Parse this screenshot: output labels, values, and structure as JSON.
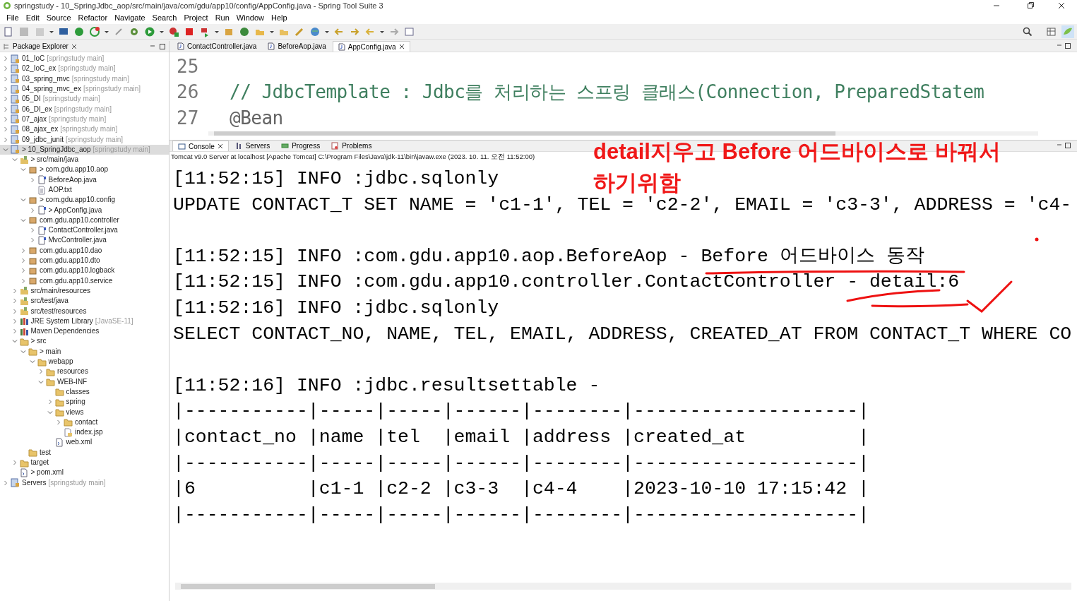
{
  "window": {
    "title": "springstudy - 10_SpringJdbc_aop/src/main/java/com/gdu/app10/config/AppConfig.java - Spring Tool Suite 3"
  },
  "menu": [
    "File",
    "Edit",
    "Source",
    "Refactor",
    "Navigate",
    "Search",
    "Project",
    "Run",
    "Window",
    "Help"
  ],
  "explorer": {
    "title": "Package Explorer",
    "items": [
      {
        "kind": "project",
        "label": "01_IoC",
        "detail": "[springstudy main]",
        "expanded": false,
        "selected": false
      },
      {
        "kind": "project",
        "label": "02_IoC_ex",
        "detail": "[springstudy main]",
        "expanded": false,
        "selected": false
      },
      {
        "kind": "project",
        "label": "03_spring_mvc",
        "detail": "[springstudy main]",
        "expanded": false,
        "selected": false
      },
      {
        "kind": "project",
        "label": "04_spring_mvc_ex",
        "detail": "[springstudy main]",
        "expanded": false,
        "selected": false
      },
      {
        "kind": "project",
        "label": "05_DI",
        "detail": "[springstudy main]",
        "expanded": false,
        "selected": false
      },
      {
        "kind": "project",
        "label": "06_DI_ex",
        "detail": "[springstudy main]",
        "expanded": false,
        "selected": false
      },
      {
        "kind": "project",
        "label": "07_ajax",
        "detail": "[springstudy main]",
        "expanded": false,
        "selected": false
      },
      {
        "kind": "project",
        "label": "08_ajax_ex",
        "detail": "[springstudy main]",
        "expanded": false,
        "selected": false
      },
      {
        "kind": "project",
        "label": "09_jdbc_junit",
        "detail": "[springstudy main]",
        "expanded": false,
        "selected": false
      },
      {
        "kind": "project",
        "label": "> 10_SpringJdbc_aop",
        "detail": "[springstudy main]",
        "expanded": true,
        "selected": true,
        "children": [
          {
            "kind": "source",
            "label": "> src/main/java",
            "expanded": true,
            "selected": false,
            "children": [
              {
                "kind": "package",
                "label": "> com.gdu.app10.aop",
                "expanded": true,
                "selected": false,
                "children": [
                  {
                    "kind": "java",
                    "label": "BeforeAop.java",
                    "expanded": false,
                    "selected": false
                  },
                  {
                    "kind": "text",
                    "label": "AOP.txt",
                    "selected": false
                  }
                ]
              },
              {
                "kind": "package",
                "label": "> com.gdu.app10.config",
                "expanded": true,
                "selected": false,
                "children": [
                  {
                    "kind": "java",
                    "label": "> AppConfig.java",
                    "expanded": false,
                    "selected": false
                  }
                ]
              },
              {
                "kind": "package",
                "label": "com.gdu.app10.controller",
                "expanded": true,
                "selected": false,
                "children": [
                  {
                    "kind": "java",
                    "label": "ContactController.java",
                    "expanded": false,
                    "selected": false
                  },
                  {
                    "kind": "java",
                    "label": "MvcController.java",
                    "expanded": false,
                    "selected": false
                  }
                ]
              },
              {
                "kind": "package",
                "label": "com.gdu.app10.dao",
                "expanded": false,
                "selected": false
              },
              {
                "kind": "package",
                "label": "com.gdu.app10.dto",
                "expanded": false,
                "selected": false
              },
              {
                "kind": "package",
                "label": "com.gdu.app10.logback",
                "expanded": false,
                "selected": false
              },
              {
                "kind": "package",
                "label": "com.gdu.app10.service",
                "expanded": false,
                "selected": false
              }
            ]
          },
          {
            "kind": "source",
            "label": "src/main/resources",
            "expanded": false,
            "selected": false
          },
          {
            "kind": "source",
            "label": "src/test/java",
            "expanded": false,
            "selected": false
          },
          {
            "kind": "source",
            "label": "src/test/resources",
            "expanded": false,
            "selected": false
          },
          {
            "kind": "library",
            "label": "JRE System Library",
            "detail": "[JavaSE-11]",
            "expanded": false,
            "selected": false
          },
          {
            "kind": "library",
            "label": "Maven Dependencies",
            "expanded": false,
            "selected": false
          },
          {
            "kind": "folder",
            "label": "> src",
            "expanded": true,
            "selected": false,
            "children": [
              {
                "kind": "folder",
                "label": "> main",
                "expanded": true,
                "selected": false,
                "children": [
                  {
                    "kind": "folder",
                    "label": "webapp",
                    "expanded": true,
                    "selected": false,
                    "children": [
                      {
                        "kind": "folder",
                        "label": "resources",
                        "expanded": false,
                        "selected": false
                      },
                      {
                        "kind": "folder",
                        "label": "WEB-INF",
                        "expanded": true,
                        "selected": false,
                        "children": [
                          {
                            "kind": "folder",
                            "label": "classes",
                            "selected": false
                          },
                          {
                            "kind": "folder",
                            "label": "spring",
                            "expanded": false,
                            "selected": false
                          },
                          {
                            "kind": "folder",
                            "label": "views",
                            "expanded": true,
                            "selected": false,
                            "children": [
                              {
                                "kind": "folder",
                                "label": "contact",
                                "expanded": false,
                                "selected": false
                              },
                              {
                                "kind": "jsp",
                                "label": "index.jsp",
                                "selected": false
                              }
                            ]
                          },
                          {
                            "kind": "xml",
                            "label": "web.xml",
                            "selected": false
                          }
                        ]
                      }
                    ]
                  }
                ]
              },
              {
                "kind": "folder",
                "label": "test",
                "selected": false
              }
            ]
          },
          {
            "kind": "folder",
            "label": "target",
            "expanded": false,
            "selected": false
          },
          {
            "kind": "xml",
            "label": "> pom.xml",
            "selected": false
          }
        ]
      },
      {
        "kind": "project",
        "label": "Servers",
        "detail": "[springstudy main]",
        "expanded": false,
        "selected": false
      }
    ]
  },
  "editor": {
    "tabs": [
      {
        "label": "ContactController.java",
        "selected": false
      },
      {
        "label": "BeforeAop.java",
        "selected": false
      },
      {
        "label": "AppConfig.java",
        "selected": true
      }
    ],
    "lines": [
      {
        "number": "25"
      },
      {
        "number": "26",
        "text": "// JdbcTemplate : Jdbc를 처리하는 스프링 클래스(Connection, PreparedStatem",
        "kind": "comment"
      },
      {
        "number": "27",
        "text": "@Bean",
        "kind": "annotation"
      }
    ]
  },
  "console": {
    "tabs": [
      {
        "label": "Console",
        "selected": true
      },
      {
        "label": "Servers",
        "selected": false
      },
      {
        "label": "Progress",
        "selected": false
      },
      {
        "label": "Problems",
        "selected": false
      }
    ],
    "process": "Tomcat v9.0 Server at localhost [Apache Tomcat] C:\\Program Files\\Java\\jdk-11\\bin\\javaw.exe  (2023. 10. 11. 오전 11:52:00)",
    "lines": [
      {
        "kind": "text",
        "text": "[11:52:15] INFO :jdbc.sqlonly"
      },
      {
        "kind": "text",
        "text": "UPDATE CONTACT_T SET NAME = 'c1-1', TEL = 'c2-2', EMAIL = 'c3-3', ADDRESS = 'c4-"
      },
      {
        "kind": "blank"
      },
      {
        "kind": "text",
        "text": "[11:52:15] INFO :com.gdu.app10.aop.BeforeAop - Before 어드바이스 동작"
      },
      {
        "kind": "text",
        "text": "[11:52:15] INFO :com.gdu.app10.controller.ContactController - detail:6"
      },
      {
        "kind": "text",
        "text": "[11:52:16] INFO :jdbc.sqlonly"
      },
      {
        "kind": "text",
        "text": "SELECT CONTACT_NO, NAME, TEL, EMAIL, ADDRESS, CREATED_AT FROM CONTACT_T WHERE CO"
      },
      {
        "kind": "blank"
      },
      {
        "kind": "text",
        "text": "[11:52:16] INFO :jdbc.resultsettable -"
      },
      {
        "kind": "text",
        "text": "|-----------|-----|-----|------|--------|--------------------|"
      },
      {
        "kind": "text",
        "text": "|contact_no |name |tel  |email |address |created_at          |"
      },
      {
        "kind": "text",
        "text": "|-----------|-----|-----|------|--------|--------------------|"
      },
      {
        "kind": "text",
        "text": "|6          |c1-1 |c2-2 |c3-3  |c4-4    |2023-10-10 17:15:42 |"
      },
      {
        "kind": "text",
        "text": "|-----------|-----|-----|------|--------|--------------------|"
      }
    ]
  },
  "annotation": {
    "lines": [
      "detail지우고 Before 어드바이스로 바꿔서",
      "하기위함"
    ]
  }
}
